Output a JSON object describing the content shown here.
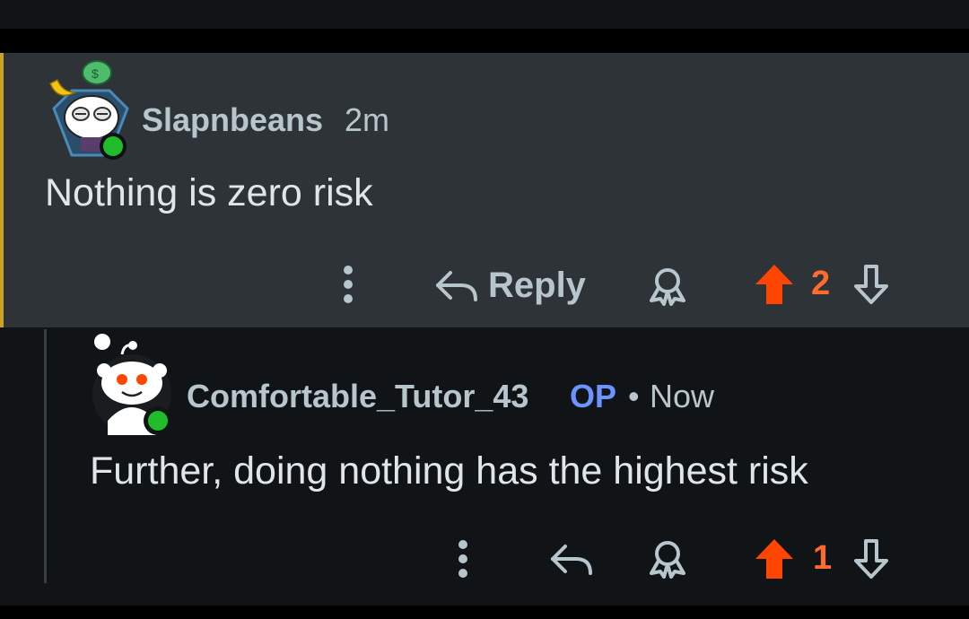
{
  "comments": [
    {
      "username": "Slapnbeans",
      "time": "2m",
      "text": "Nothing is zero risk",
      "reply_label": "Reply",
      "votes": "2",
      "vote_color": "#ff4500",
      "online": true
    },
    {
      "username": "Comfortable_Tutor_43",
      "op_badge": "OP",
      "separator": "•",
      "time": "Now",
      "text": "Further, doing nothing has the highest risk",
      "votes": "1",
      "vote_color": "#ff4500",
      "online": true
    }
  ],
  "icons": {
    "more": "more-options-icon",
    "reply": "reply-arrow-icon",
    "award": "award-icon",
    "upvote": "upvote-arrow-icon",
    "downvote": "downvote-arrow-icon"
  },
  "colors": {
    "accent_bar": "#c9a227",
    "op_badge": "#6d93ff",
    "online_dot": "#1fbd2a"
  }
}
